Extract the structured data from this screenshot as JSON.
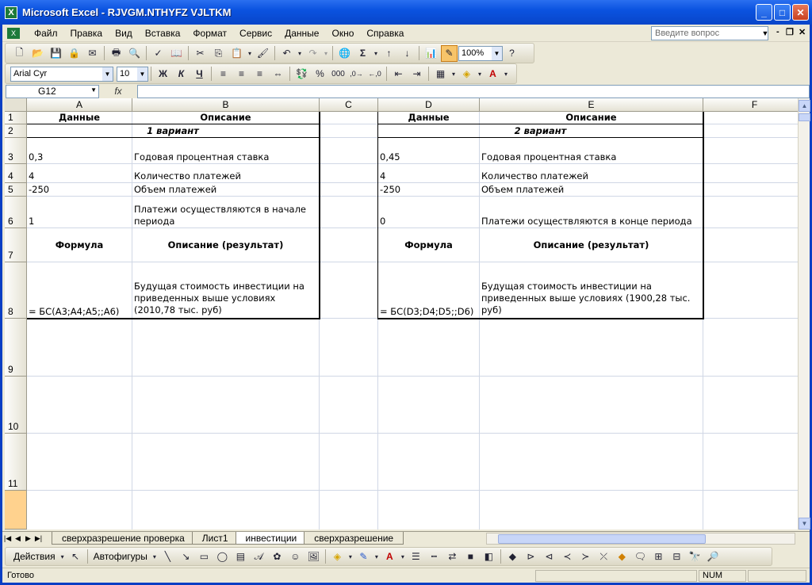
{
  "window": {
    "title": "Microsoft Excel - RJVGM.NTHYFZ VJLTKM",
    "icon": "excel-icon",
    "controls": [
      "minimize",
      "maximize",
      "close"
    ]
  },
  "menu": {
    "items": [
      "Файл",
      "Правка",
      "Вид",
      "Вставка",
      "Формат",
      "Сервис",
      "Данные",
      "Окно",
      "Справка"
    ],
    "help_placeholder": "Введите вопрос"
  },
  "toolbar": {
    "zoom": "100%",
    "font_name": "Arial Cyr",
    "font_size": "10",
    "bold": "Ж",
    "italic": "К",
    "underline": "Ч",
    "percent": "%",
    "thousands": "000",
    "sum": "Σ"
  },
  "formula_bar": {
    "name_box": "G12",
    "fx": "fx",
    "value": ""
  },
  "grid": {
    "columns": [
      "A",
      "B",
      "C",
      "D",
      "E",
      "F"
    ],
    "rows": [
      "1",
      "2",
      "3",
      "4",
      "5",
      "6",
      "7",
      "8",
      "9",
      "10",
      "11",
      ""
    ],
    "cells": {
      "A1": "Данные",
      "B1": "Описание",
      "A2B2": "1 вариант",
      "A3": "0,3",
      "B3": "Годовая процентная ставка",
      "A4": "4",
      "B4": "Количество платежей",
      "A5": "-250",
      "B5": "Объем платежей",
      "A6": "1",
      "B6": "Платежи осуществляются в начале периода",
      "A7": "Формула",
      "B7": "Описание (результат)",
      "A8": "= БС(A3;A4;A5;;A6)",
      "B8": "Будущая стоимость инвестиции на приведенных выше условиях (2010,78 тыс. руб)",
      "D1": "Данные",
      "E1": "Описание",
      "D2E2": "2 вариант",
      "D3": "0,45",
      "E3": "Годовая процентная ставка",
      "D4": "4",
      "E4": "Количество платежей",
      "D5": "-250",
      "E5": "Объем платежей",
      "D6": "0",
      "E6": "Платежи осуществляются в конце периода",
      "D7": "Формула",
      "E7": "Описание (результат)",
      "D8": "= БС(D3;D4;D5;;D6)",
      "E8": "Будущая стоимость инвестиции на приведенных выше условиях (1900,28 тыс. руб)"
    }
  },
  "sheets": {
    "tabs": [
      "сверхразрешение проверка",
      "Лист1",
      "инвестиции",
      "сверхразрешение"
    ],
    "active": "инвестиции"
  },
  "drawing_toolbar": {
    "actions": "Действия",
    "autoshapes": "Автофигуры"
  },
  "status": {
    "ready": "Готово",
    "num": "NUM"
  },
  "colors": {
    "titlebar": "#0b53e0",
    "selected_row_header": "#ffd28e",
    "grid_line": "#d0d7e5"
  }
}
